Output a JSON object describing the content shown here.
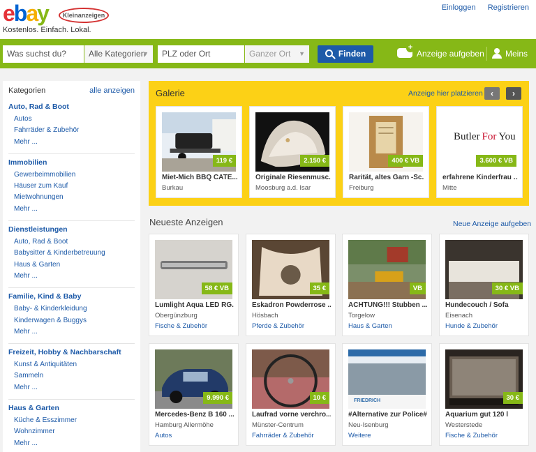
{
  "header": {
    "logo_letters": [
      "e",
      "b",
      "a",
      "y"
    ],
    "logo_colors": [
      "#e53238",
      "#0064d2",
      "#f5af02",
      "#86b817"
    ],
    "badge": "Kleinanzeigen",
    "tagline": "Kostenlos. Einfach. Lokal.",
    "login": "Einloggen",
    "register": "Registrieren"
  },
  "search": {
    "query_placeholder": "Was suchst du?",
    "category": "Alle Kategorien",
    "location_placeholder": "PLZ oder Ort",
    "radius": "Ganzer Ort",
    "find": "Finden",
    "post_ad": "Anzeige aufgeben",
    "mine": "Meins"
  },
  "sidebar": {
    "title": "Kategorien",
    "all": "alle anzeigen",
    "groups": [
      {
        "title": "Auto, Rad & Boot",
        "items": [
          "Autos",
          "Fahrräder & Zubehör",
          "Mehr ..."
        ]
      },
      {
        "title": "Immobilien",
        "items": [
          "Gewerbeimmobilien",
          "Häuser zum Kauf",
          "Mietwohnungen",
          "Mehr ..."
        ]
      },
      {
        "title": "Dienstleistungen",
        "items": [
          "Auto, Rad & Boot",
          "Babysitter & Kinderbetreuung",
          "Haus & Garten",
          "Mehr ..."
        ]
      },
      {
        "title": "Familie, Kind & Baby",
        "items": [
          "Baby- & Kinderkleidung",
          "Kinderwagen & Buggys",
          "Mehr ..."
        ]
      },
      {
        "title": "Freizeit, Hobby & Nachbarschaft",
        "items": [
          "Kunst & Antiquitäten",
          "Sammeln",
          "Mehr ..."
        ]
      },
      {
        "title": "Haus & Garten",
        "items": [
          "Küche & Esszimmer",
          "Wohnzimmer",
          "Mehr ..."
        ]
      }
    ]
  },
  "gallery": {
    "title": "Galerie",
    "place_link": "Anzeige hier platzieren",
    "prev": "‹",
    "next": "›",
    "items": [
      {
        "title": "Miet-Mich BBQ CATE...",
        "location": "Burkau",
        "price": "119 €"
      },
      {
        "title": "Originale Riesenmusc...",
        "location": "Moosburg a.d. Isar",
        "price": "2.150 €"
      },
      {
        "title": "Rarität, altes Garn -Sc...",
        "location": "Freiburg",
        "price": "400 € VB"
      },
      {
        "title": "erfahrene Kinderfrau ...",
        "location": "Mitte",
        "price": "3.600 € VB",
        "logo": [
          "Butler",
          "For",
          "You"
        ]
      }
    ]
  },
  "latest": {
    "title": "Neueste Anzeigen",
    "post_link": "Neue Anzeige aufgeben",
    "items": [
      {
        "title": "Lumlight Aqua LED RG...",
        "location": "Obergünzburg",
        "category": "Fische & Zubehör",
        "price": "58 € VB"
      },
      {
        "title": "Eskadron Powderrose ...",
        "location": "Hösbach",
        "category": "Pferde & Zubehör",
        "price": "35 €"
      },
      {
        "title": "ACHTUNG!!! Stubben ...",
        "location": "Torgelow",
        "category": "Haus & Garten",
        "price": "VB"
      },
      {
        "title": "Hundecouch / Sofa",
        "location": "Eisenach",
        "category": "Hunde & Zubehör",
        "price": "30 € VB"
      },
      {
        "title": "Mercedes-Benz B 160 ...",
        "location": "Hamburg Allermöhe",
        "category": "Autos",
        "price": "9.990 €"
      },
      {
        "title": "Laufrad vorne verchro...",
        "location": "Münster-Centrum",
        "category": "Fahrräder & Zubehör",
        "price": "10 €"
      },
      {
        "title": "#Alternative zur Police#",
        "location": "Neu-Isenburg",
        "category": "Weitere",
        "price": "",
        "banner": "FRIEDRICH"
      },
      {
        "title": "Aquarium gut 120 l",
        "location": "Westerstede",
        "category": "Fische & Zubehör",
        "price": "30 €"
      }
    ]
  }
}
